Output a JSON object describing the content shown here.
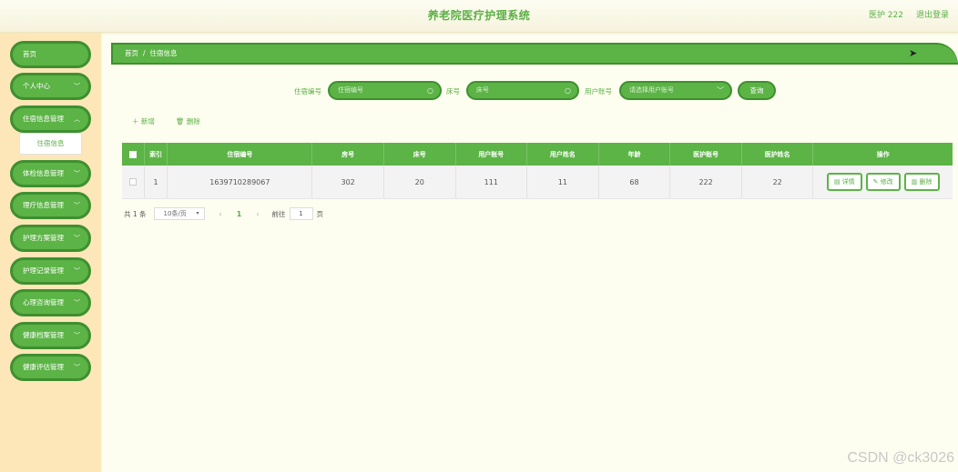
{
  "header": {
    "title": "养老院医疗护理系统",
    "user": "医护 222",
    "logout": "退出登录"
  },
  "sidebar": {
    "items": [
      {
        "label": "首页",
        "chevron": false
      },
      {
        "label": "个人中心",
        "chevron": true
      },
      {
        "label": "住宿信息管理",
        "chevron": true
      },
      {
        "label": "体检信息管理",
        "chevron": true
      },
      {
        "label": "理疗信息管理",
        "chevron": true
      },
      {
        "label": "护理方案管理",
        "chevron": true
      },
      {
        "label": "护理记录管理",
        "chevron": true
      },
      {
        "label": "心理咨询管理",
        "chevron": true
      },
      {
        "label": "健康档案管理",
        "chevron": true
      },
      {
        "label": "健康评估管理",
        "chevron": true
      }
    ],
    "submenu": {
      "label": "住宿信息"
    }
  },
  "breadcrumb": {
    "home": "首页",
    "separator": "/",
    "current": "住宿信息"
  },
  "search": {
    "field1": {
      "label": "住宿编号",
      "placeholder": "住宿编号"
    },
    "field2": {
      "label": "床号",
      "placeholder": "床号"
    },
    "field3": {
      "label": "用户账号",
      "placeholder": "请选择用户账号"
    },
    "query_button": "查询"
  },
  "actions": {
    "add": "新增",
    "delete": "删除"
  },
  "table": {
    "columns": [
      "索引",
      "住宿编号",
      "房号",
      "床号",
      "用户账号",
      "用户姓名",
      "年龄",
      "医护账号",
      "医护姓名",
      "操作"
    ],
    "rows": [
      {
        "index": "1",
        "stay_no": "1639710289067",
        "room": "302",
        "bed": "20",
        "user_account": "111",
        "user_name": "11",
        "age": "68",
        "staff_account": "222",
        "staff_name": "22"
      }
    ],
    "ops": {
      "detail": "详情",
      "edit": "修改",
      "delete": "删除"
    }
  },
  "pagination": {
    "total": "共 1 条",
    "page_size": "10条/页",
    "current_page": "1",
    "goto_label": "前往",
    "goto_value": "1",
    "page_suffix": "页"
  },
  "watermark": "CSDN @ck3026",
  "colors": {
    "accent": "#5cb346",
    "accent_dark": "#3f8f30",
    "sidebar_bg": "#fde7b8",
    "page_bg": "#fefef0"
  }
}
